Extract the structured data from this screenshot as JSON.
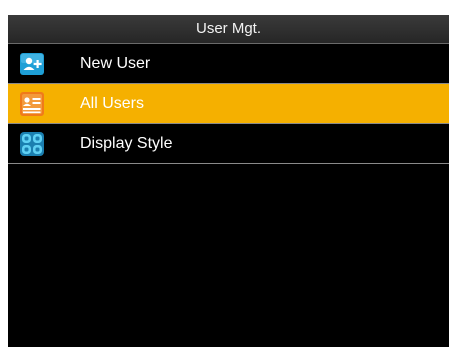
{
  "header": {
    "title": "User Mgt."
  },
  "menu": {
    "items": [
      {
        "label": "New User",
        "icon": "add-user-icon",
        "selected": false
      },
      {
        "label": "All Users",
        "icon": "user-list-icon",
        "selected": true
      },
      {
        "label": "Display Style",
        "icon": "display-style-icon",
        "selected": false
      }
    ]
  },
  "colors": {
    "selection_highlight": "#f5b000",
    "background": "#000000",
    "header_background": "#303030",
    "add_user_icon": "#1e9fd6",
    "user_list_icon": "#f07a1a",
    "display_style_icon": "#3bb6e6"
  }
}
